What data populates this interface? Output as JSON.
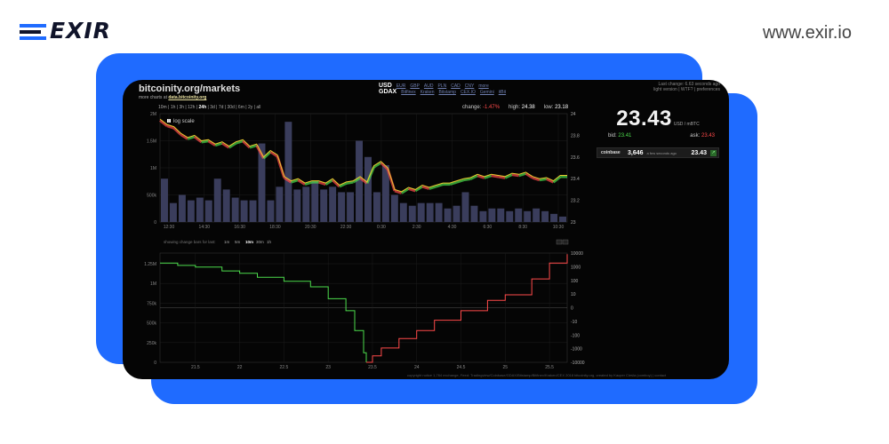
{
  "brand": {
    "logo_text": "EXIR",
    "url": "www.exir.io"
  },
  "site": {
    "title": "bitcoinity.org/markets",
    "sub_prefix": "more charts at",
    "sub_link": "data.bitcoinity.org"
  },
  "currency": {
    "selected": "USD",
    "options": [
      "EUR",
      "GBP",
      "AUD",
      "PLN",
      "CAD",
      "CNY",
      "more"
    ],
    "exchange_selected": "GDAX",
    "exchanges": [
      "Bitfinex",
      "Kraken",
      "Bitstamp",
      "CEX.IO",
      "Gemini",
      "itBit"
    ]
  },
  "last_change": {
    "line1": "Last change: 6.63 seconds ago",
    "line2": "light version | WTF? | preferences"
  },
  "timeframes": [
    "10m",
    "1h",
    "3h",
    "12h",
    "24h",
    "3d",
    "7d",
    "30d",
    "6m",
    "2y",
    "all"
  ],
  "timeframe_selected": "24h",
  "stats": {
    "change_label": "change:",
    "change_value": "-1.47%",
    "high_label": "high:",
    "high_value": "24.38",
    "low_label": "low:",
    "low_value": "23.18"
  },
  "log_scale_label": "log scale",
  "price": {
    "value": "23.43",
    "unit": "USD / mBTC"
  },
  "bid": {
    "label": "bid:",
    "value": "23.41"
  },
  "ask": {
    "label": "ask:",
    "value": "23.43"
  },
  "exchange_row": {
    "name": "coinbase",
    "volume": "3,646",
    "ago": "a few seconds ago",
    "price": "23.43"
  },
  "change_bars": {
    "label": "showing change bars for last:",
    "options": [
      "1m",
      "5m",
      "10m",
      "30m",
      "1h"
    ],
    "selected": "10m"
  },
  "footer": "copyright notice 1,764 exchange, Feed: Tradingview/Coinbase/GDAX/Bitstamp/Bitfinex/Kraken/CEX 2018 bitcoinity.org, created by Kacper Cieśla (comboy) | contact",
  "colors": {
    "accent": "#1f6bff",
    "up": "#4cdc4c",
    "down": "#ff4a4a",
    "price_line": "#e8c830"
  },
  "chart_data": [
    {
      "type": "line",
      "title": "",
      "x_ticks": [
        "12:30",
        "14:30",
        "16:30",
        "18:30",
        "20:30",
        "22:30",
        "0:30",
        "2:30",
        "4:30",
        "6:30",
        "8:30",
        "10:30"
      ],
      "y_right_ticks": [
        "24",
        "23.8",
        "23.6",
        "23.4",
        "23.2",
        "23"
      ],
      "y_left_ticks": [
        "2M",
        "1.5M",
        "1M",
        "500k",
        "0"
      ],
      "ylim_right": [
        23,
        24
      ],
      "ylim_left": [
        0,
        2000000
      ],
      "price_series": [
        23.95,
        23.9,
        23.88,
        23.82,
        23.78,
        23.8,
        23.75,
        23.76,
        23.72,
        23.74,
        23.7,
        23.74,
        23.76,
        23.7,
        23.72,
        23.6,
        23.66,
        23.62,
        23.42,
        23.38,
        23.4,
        23.36,
        23.38,
        23.38,
        23.36,
        23.4,
        23.34,
        23.37,
        23.38,
        23.42,
        23.37,
        23.52,
        23.56,
        23.5,
        23.3,
        23.28,
        23.32,
        23.3,
        23.34,
        23.32,
        23.34,
        23.36,
        23.36,
        23.38,
        23.4,
        23.41,
        23.44,
        23.42,
        23.44,
        23.43,
        23.42,
        23.45,
        23.44,
        23.46,
        23.42,
        23.4,
        23.41,
        23.38,
        23.43,
        23.43
      ],
      "volume_bars": [
        800000,
        350000,
        500000,
        400000,
        450000,
        400000,
        800000,
        600000,
        450000,
        400000,
        400000,
        1450000,
        400000,
        650000,
        1850000,
        600000,
        650000,
        750000,
        600000,
        650000,
        550000,
        550000,
        1500000,
        1200000,
        550000,
        1050000,
        500000,
        350000,
        300000,
        350000,
        350000,
        350000,
        250000,
        300000,
        550000,
        300000,
        200000,
        250000,
        250000,
        200000,
        250000,
        200000,
        250000,
        200000,
        150000,
        100000
      ]
    },
    {
      "type": "line",
      "title": "",
      "x_ticks": [
        "21.5",
        "22",
        "22.5",
        "23",
        "23.5",
        "24",
        "24.5",
        "25",
        "25.5"
      ],
      "y_left_ticks": [
        "1.25M",
        "1M",
        "750k",
        "500k",
        "250k",
        "0"
      ],
      "y_right_ticks": [
        "10000",
        "1000",
        "100",
        "10",
        "0",
        "-10",
        "-100",
        "-1000",
        "-10000"
      ],
      "xlim": [
        21.1,
        25.7
      ],
      "ylim_left": [
        0,
        1375000
      ],
      "bid_depth": [
        [
          21.1,
          1250000
        ],
        [
          21.3,
          1220000
        ],
        [
          21.5,
          1200000
        ],
        [
          21.8,
          1150000
        ],
        [
          22.0,
          1120000
        ],
        [
          22.2,
          1070000
        ],
        [
          22.5,
          1020000
        ],
        [
          22.8,
          950000
        ],
        [
          23.0,
          800000
        ],
        [
          23.2,
          650000
        ],
        [
          23.3,
          400000
        ],
        [
          23.4,
          120000
        ],
        [
          23.43,
          0
        ]
      ],
      "ask_depth": [
        [
          23.43,
          0
        ],
        [
          23.5,
          80000
        ],
        [
          23.6,
          180000
        ],
        [
          23.8,
          300000
        ],
        [
          24.0,
          400000
        ],
        [
          24.2,
          530000
        ],
        [
          24.5,
          650000
        ],
        [
          24.8,
          780000
        ],
        [
          25.0,
          850000
        ],
        [
          25.3,
          1050000
        ],
        [
          25.5,
          1250000
        ],
        [
          25.7,
          1360000
        ]
      ]
    }
  ]
}
